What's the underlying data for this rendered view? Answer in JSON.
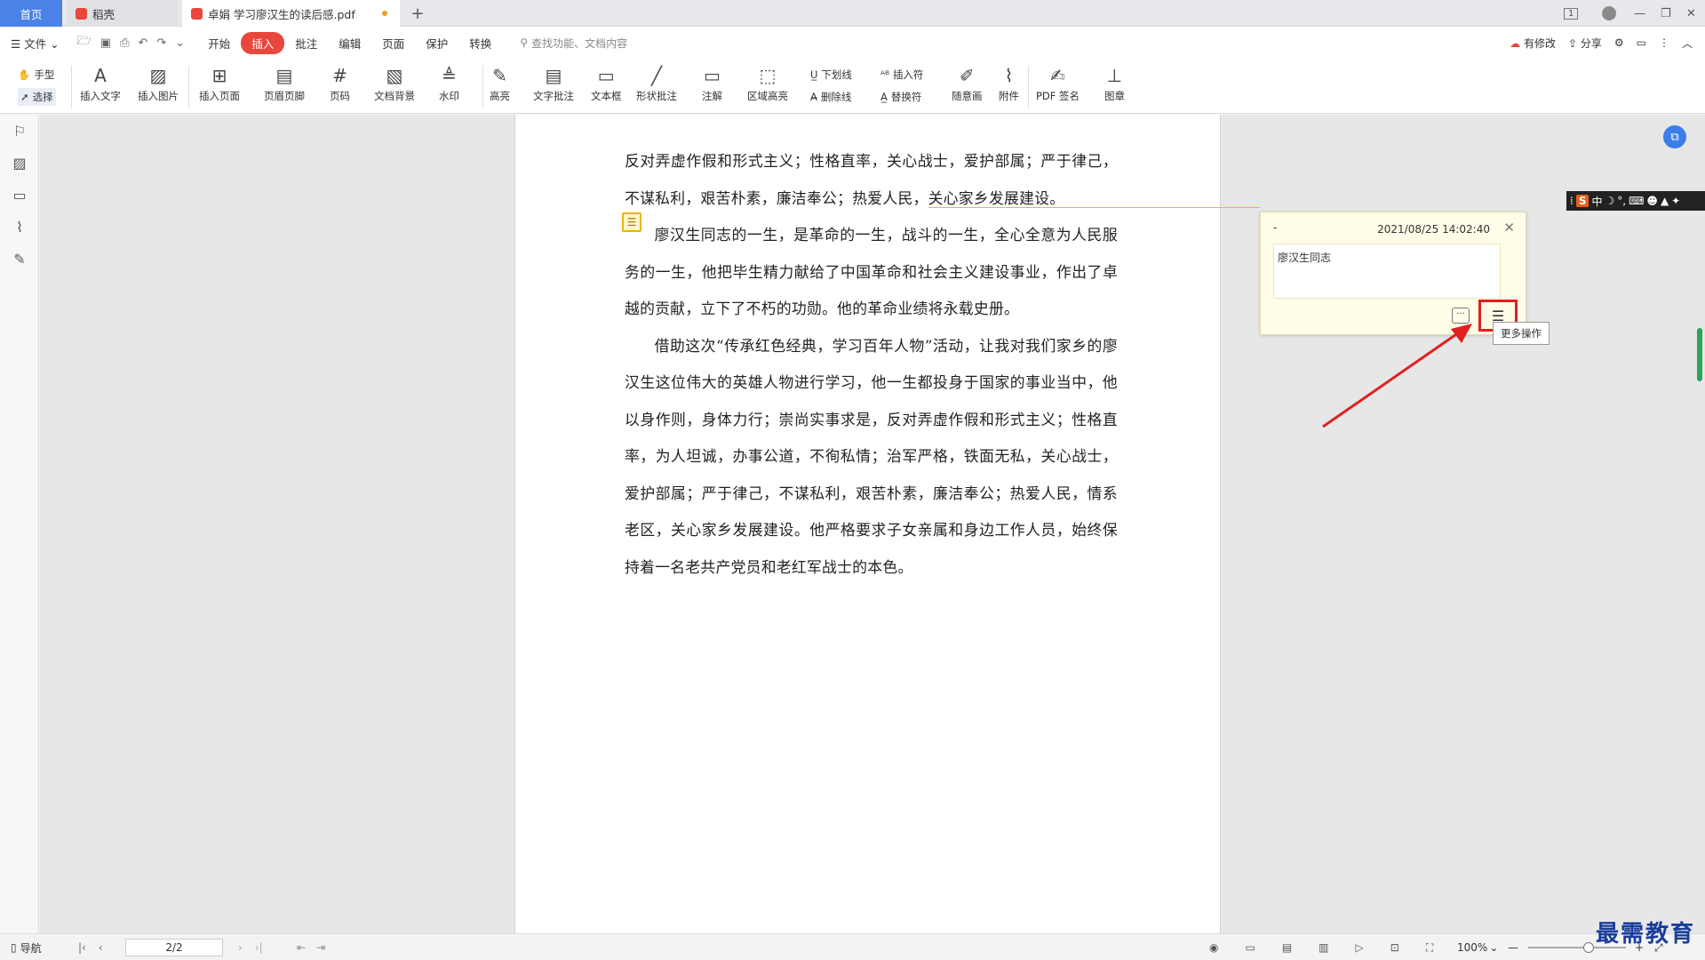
{
  "tabs": {
    "home": "首页",
    "daoke": "稻壳",
    "doc": "卓娟 学习廖汉生的读后感.pdf",
    "new": "+"
  },
  "window": {
    "badge": "1",
    "minimize": "—",
    "restore": "❐",
    "close": "✕"
  },
  "menu": {
    "file": "文件",
    "items": [
      "开始",
      "插入",
      "批注",
      "编辑",
      "页面",
      "保护",
      "转换"
    ],
    "active": "插入",
    "search_placeholder": "查找功能、文档内容",
    "right": {
      "modified": "有修改",
      "share": "分享"
    }
  },
  "toolbar": {
    "hand": "手型",
    "select": "选择",
    "insert_text": "插入文字",
    "insert_image": "插入图片",
    "insert_page": "插入页面",
    "header_footer": "页眉页脚",
    "page_number": "页码",
    "doc_background": "文档背景",
    "watermark": "水印",
    "highlight": "高亮",
    "text_comment": "文字批注",
    "text_box": "文本框",
    "shape_comment": "形状批注",
    "note": "注解",
    "area_highlight": "区域高亮",
    "underline": "下划线",
    "strikethrough": "删除线",
    "insert_char": "插入符",
    "replace_char": "替换符",
    "freehand": "随意画",
    "attachment": "附件",
    "pdf_sign": "PDF 签名",
    "stamp": "图章"
  },
  "document": {
    "paragraphs": [
      {
        "indent": false,
        "text": "反对弄虚作假和形式主义；性格直率，关心战士，爱护部属；严于律己，不谋私利，艰苦朴素，廉洁奉公；热爱人民，关心家乡发展建设。"
      },
      {
        "indent": true,
        "text": "廖汉生同志的一生，是革命的一生，战斗的一生，全心全意为人民服务的一生，他把毕生精力献给了中国革命和社会主义建设事业，作出了卓越的贡献，立下了不朽的功勋。他的革命业绩将永载史册。"
      },
      {
        "indent": true,
        "text": "借助这次“传承红色经典，学习百年人物”活动，让我对我们家乡的廖汉生这位伟大的英雄人物进行学习，他一生都投身于国家的事业当中，他以身作则，身体力行；崇尚实事求是，反对弄虚作假和形式主义；性格直率，为人坦诚，办事公道，不徇私情；治军严格，铁面无私，关心战士，爱护部属；严于律己，不谋私利，艰苦朴素，廉洁奉公；热爱人民，情系老区，关心家乡发展建设。他严格要求子女亲属和身边工作人员，始终保持着一名老共产党员和老红军战士的本色。"
      }
    ]
  },
  "comment": {
    "author": "-",
    "timestamp": "2021/08/25 14:02:40",
    "content": "廖汉生同志",
    "more_tooltip": "更多操作"
  },
  "status": {
    "nav": "导航",
    "page": "2/2",
    "zoom": "100%"
  },
  "watermark_text": "最需教育",
  "colors": {
    "accent": "#e9463c",
    "home_tab": "#4a82e6",
    "highlight_box": "#e02020",
    "comment_bg": "#fffce8"
  }
}
